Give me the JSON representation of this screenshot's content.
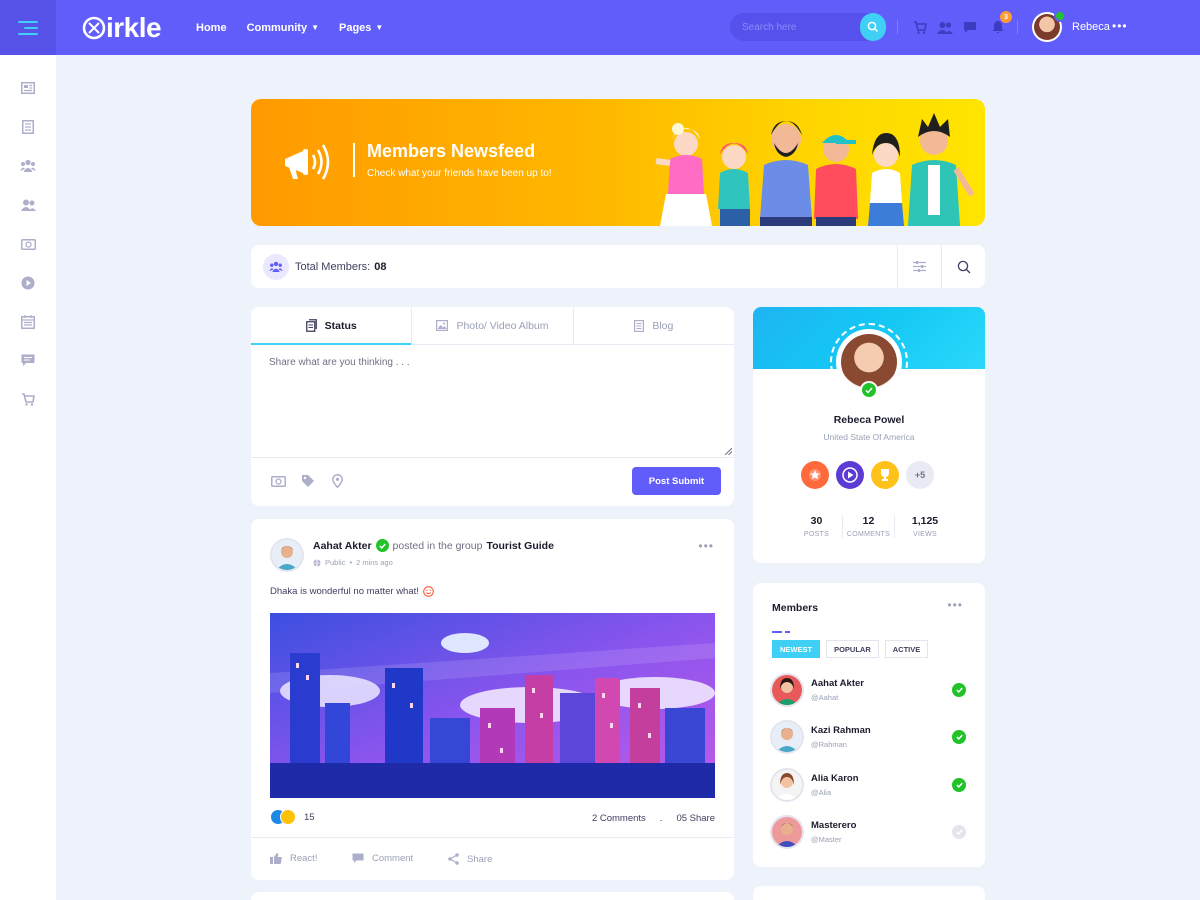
{
  "app": {
    "brand": "irkle",
    "nav": [
      {
        "label": "Home"
      },
      {
        "label": "Community"
      },
      {
        "label": "Pages"
      }
    ],
    "search_placeholder": "Search here",
    "notification_count": "3",
    "username": "Rebeca",
    "accent": "#615dfa",
    "secondary": "#40d0f5"
  },
  "sidebar": {
    "items": [
      {
        "icon": "newsfeed-icon"
      },
      {
        "icon": "forum-icon"
      },
      {
        "icon": "groups-icon"
      },
      {
        "icon": "members-icon"
      },
      {
        "icon": "badges-icon"
      },
      {
        "icon": "streams-icon"
      },
      {
        "icon": "events-icon"
      },
      {
        "icon": "messages-icon"
      },
      {
        "icon": "marketplace-icon"
      }
    ]
  },
  "banner": {
    "title": "Members Newsfeed",
    "subtitle": "Check what your friends have been up to!"
  },
  "members_bar": {
    "label": "Total Members:",
    "count": "08"
  },
  "composer": {
    "tabs": [
      {
        "label": "Status",
        "icon": "status-icon"
      },
      {
        "label": "Photo/ Video Album",
        "icon": "photo-icon"
      },
      {
        "label": "Blog",
        "icon": "blog-icon"
      }
    ],
    "placeholder": "Share what are you thinking . . .",
    "submit_label": "Post Submit"
  },
  "post": {
    "author": "Aahat Akter",
    "posted_in": "posted in the group",
    "group": "Tourist Guide",
    "visibility": "Public",
    "time": "2 mins ago",
    "text": "Dhaka is wonderful no matter what!",
    "reaction_count": "15",
    "comments": "2 Comments",
    "shares": "05 Share",
    "actions": [
      {
        "label": "React!",
        "icon": "thumbs-up-icon"
      },
      {
        "label": "Comment",
        "icon": "comment-icon"
      },
      {
        "label": "Share",
        "icon": "share-icon"
      }
    ]
  },
  "profile": {
    "name": "Rebeca Powel",
    "country": "United State Of America",
    "more_badges": "+5",
    "stats": [
      {
        "value": "30",
        "label": "POSTS"
      },
      {
        "value": "12",
        "label": "COMMENTS"
      },
      {
        "value": "1,125",
        "label": "VIEWS"
      }
    ]
  },
  "members_widget": {
    "title": "Members",
    "filters": [
      {
        "label": "NEWEST",
        "active": true
      },
      {
        "label": "POPULAR",
        "active": false
      },
      {
        "label": "ACTIVE",
        "active": false
      }
    ],
    "members": [
      {
        "name": "Aahat Akter",
        "handle": "@Aahat",
        "online": true
      },
      {
        "name": "Kazi Rahman",
        "handle": "@Rahman",
        "online": true
      },
      {
        "name": "Alia Karon",
        "handle": "@Alia",
        "online": true
      },
      {
        "name": "Masterero",
        "handle": "@Master",
        "online": false
      }
    ]
  }
}
